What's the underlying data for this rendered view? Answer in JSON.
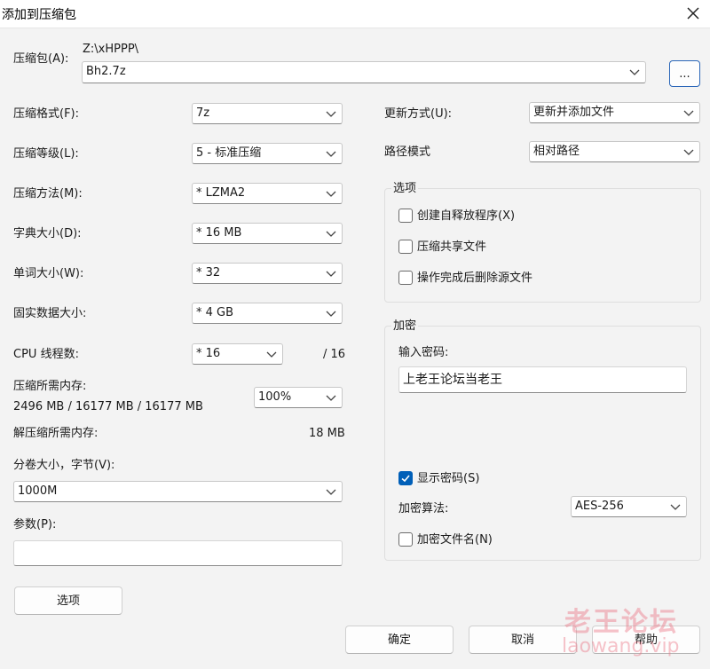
{
  "window": {
    "title": "添加到压缩包"
  },
  "archive": {
    "label": "压缩包(A):",
    "path": "Z:\\xHPPP\\",
    "name": "Bh2.7z",
    "browse_label": "..."
  },
  "left": {
    "format": {
      "label": "压缩格式(F):",
      "value": "7z"
    },
    "level": {
      "label": "压缩等级(L):",
      "value": "5 - 标准压缩"
    },
    "method": {
      "label": "压缩方法(M):",
      "value": "*  LZMA2"
    },
    "dict": {
      "label": "字典大小(D):",
      "value": "*  16 MB"
    },
    "word": {
      "label": "单词大小(W):",
      "value": "*  32"
    },
    "solid": {
      "label": "固实数据大小:",
      "value": "*  4 GB"
    },
    "threads": {
      "label": "CPU 线程数:",
      "value": "*  16",
      "max": "/ 16"
    },
    "mem_compress": {
      "label": "压缩所需内存:",
      "value": "2496 MB / 16177 MB / 16177 MB",
      "percent": "100%"
    },
    "mem_decompress": {
      "label": "解压缩所需内存:",
      "value": "18 MB"
    },
    "volume": {
      "label": "分卷大小，字节(V):",
      "value": "1000M"
    },
    "params": {
      "label": "参数(P):",
      "value": ""
    },
    "options_button": "选项"
  },
  "right": {
    "update": {
      "label": "更新方式(U):",
      "value": "更新并添加文件"
    },
    "pathmode": {
      "label": "路径模式",
      "value": "相对路径"
    },
    "options": {
      "title": "选项",
      "sfx": "创建自释放程序(X)",
      "shared": "压缩共享文件",
      "delete": "操作完成后删除源文件"
    },
    "encryption": {
      "title": "加密",
      "password_label": "输入密码:",
      "password": "上老王论坛当老王",
      "show_password": "显示密码(S)",
      "algo_label": "加密算法:",
      "algo": "AES-256",
      "encrypt_names": "加密文件名(N)"
    }
  },
  "buttons": {
    "ok": "确定",
    "cancel": "取消",
    "help": "帮助"
  },
  "watermark": {
    "cn": "老王论坛",
    "url": "laowang.vip"
  }
}
